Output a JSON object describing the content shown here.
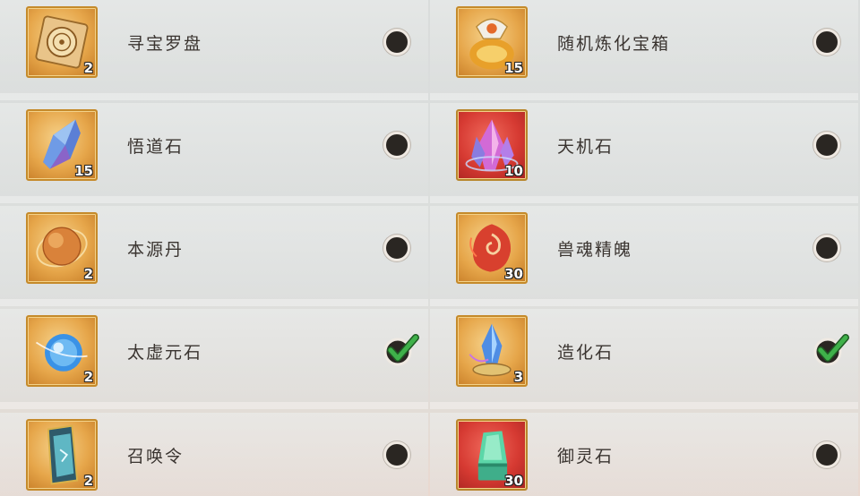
{
  "items_left": [
    {
      "name": "寻宝罗盘",
      "count": "2",
      "frame": "gold",
      "icon": "compass-icon",
      "selected": false
    },
    {
      "name": "悟道石",
      "count": "15",
      "frame": "gold",
      "icon": "blue-crystal-icon",
      "selected": false
    },
    {
      "name": "本源丹",
      "count": "2",
      "frame": "gold",
      "icon": "orb-pill-icon",
      "selected": false
    },
    {
      "name": "太虚元石",
      "count": "2",
      "frame": "gold",
      "icon": "blue-orb-icon",
      "selected": true
    },
    {
      "name": "召唤令",
      "count": "2",
      "frame": "gold",
      "icon": "summon-token-icon",
      "selected": false
    }
  ],
  "items_right": [
    {
      "name": "随机炼化宝箱",
      "count": "15",
      "frame": "gold",
      "icon": "treasure-bag-icon",
      "selected": false
    },
    {
      "name": "天机石",
      "count": "10",
      "frame": "red",
      "icon": "pink-crystal-icon",
      "selected": false
    },
    {
      "name": "兽魂精魄",
      "count": "30",
      "frame": "gold",
      "icon": "beast-soul-icon",
      "selected": false
    },
    {
      "name": "造化石",
      "count": "3",
      "frame": "gold",
      "icon": "creation-crystal-icon",
      "selected": true
    },
    {
      "name": "御灵石",
      "count": "30",
      "frame": "red",
      "icon": "jade-stone-icon",
      "selected": false
    }
  ],
  "colors": {
    "check": "#3fb14a",
    "radio": "#2a2622",
    "gold_frame": "#c58a2a",
    "red_frame": "#d63a32"
  }
}
